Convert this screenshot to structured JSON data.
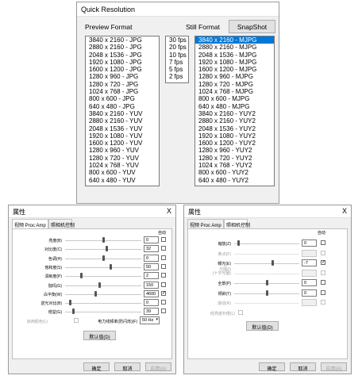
{
  "quick_resolution": {
    "title": "Quick Resolution",
    "preview_label": "Preview Format",
    "still_label": "Still Format",
    "snapshot_label": "SnapShot",
    "preview_formats": [
      "3840 x 2160 - JPG",
      "2880 x 2160 - JPG",
      "2048 x 1536 - JPG",
      "1920 x 1080 - JPG",
      "1600 x 1200 - JPG",
      "1280 x 960 - JPG",
      "1280 x 720 - JPG",
      "1024 x 768 - JPG",
      "800 x 600 - JPG",
      "640 x 480 - JPG",
      "3840 x 2160 - YUV",
      "2880 x 2160 - YUV",
      "2048 x 1536 - YUV",
      "1920 x 1080 - YUV",
      "1600 x 1200 - YUV",
      "1280 x 960 - YUV",
      "1280 x 720 - YUV",
      "1024 x 768 - YUV",
      "800 x 600 - YUV",
      "640 x 480 - YUV"
    ],
    "fps_options": [
      "30 fps",
      "20 fps",
      "10 fps",
      "7 fps",
      "5 fps",
      "2 fps"
    ],
    "still_formats": [
      "3840 x 2160 - MJPG",
      "2880 x 2160 - MJPG",
      "2048 x 1536 - MJPG",
      "1920 x 1080 - MJPG",
      "1600 x 1200 - MJPG",
      "1280 x 960 - MJPG",
      "1280 x 720 - MJPG",
      "1024 x 768 - MJPG",
      "800 x 600 - MJPG",
      "640 x 480 - MJPG",
      "3840 x 2160 - YUY2",
      "2880 x 2160 - YUY2",
      "2048 x 1536 - YUY2",
      "1920 x 1080 - YUY2",
      "1600 x 1200 - YUY2",
      "1280 x 960 - YUY2",
      "1280 x 720 - YUY2",
      "1024 x 768 - YUY2",
      "800 x 600 - YUY2",
      "640 x 480 - YUY2"
    ]
  },
  "left_dialog": {
    "title": "属性",
    "close": "X",
    "tabs": [
      "视频 Proc Amp",
      "照相机控制"
    ],
    "auto_label": "自动",
    "rows": [
      {
        "label": "亮度(B)",
        "value": "0",
        "level": 0.5
      },
      {
        "label": "对比度(C)",
        "value": "32",
        "level": 0.55
      },
      {
        "label": "色调(H)",
        "value": "0",
        "level": 0.5
      },
      {
        "label": "饱和度(S)",
        "value": "50",
        "level": 0.6
      },
      {
        "label": "清晰度(P)",
        "value": "2",
        "level": 0.2
      },
      {
        "label": "伽玛(G)",
        "value": "150",
        "level": 0.45
      },
      {
        "label": "白平衡(W)",
        "value": "4600",
        "level": 0.4,
        "auto_checked": true
      },
      {
        "label": "逆光对比(B)",
        "value": "0",
        "level": 0.05
      },
      {
        "label": "增益(G)",
        "value": "39",
        "level": 0.1
      }
    ],
    "color_enable_label": "启用颜色(L)",
    "power_freq_label": "电力线频率(防闪烁)(F)",
    "power_freq_value": "50 Hz",
    "default_button": "默认值(D)",
    "ok_button": "确定",
    "cancel_button": "取消",
    "apply_button": "应用(A)"
  },
  "right_dialog": {
    "title": "属性",
    "close": "X",
    "tabs": [
      "视频 Proc Amp",
      "照相机控制"
    ],
    "auto_label": "自动",
    "rows": [
      {
        "label": "缩放(Z)",
        "value": "0",
        "level": 0.05,
        "enabled": true
      },
      {
        "label": "焦点(F)",
        "value": "",
        "level": null,
        "enabled": false
      },
      {
        "label": "曝光(E)",
        "value": "-7",
        "level": 0.6,
        "enabled": true,
        "auto_checked": true
      },
      {
        "label": "光圈(I)\n(十字光圈)",
        "value": "",
        "level": null,
        "enabled": false
      },
      {
        "label": "全景(P)",
        "value": "0",
        "level": 0.5,
        "enabled": true
      },
      {
        "label": "倾斜(T)",
        "value": "0",
        "level": 0.5,
        "enabled": true
      },
      {
        "label": "滚动(R)",
        "value": "",
        "level": null,
        "enabled": false
      }
    ],
    "low_light_label": "低亮度补偿(L)",
    "default_button": "默认值(D)",
    "ok_button": "确定",
    "cancel_button": "取消",
    "apply_button": "应用(A)"
  }
}
